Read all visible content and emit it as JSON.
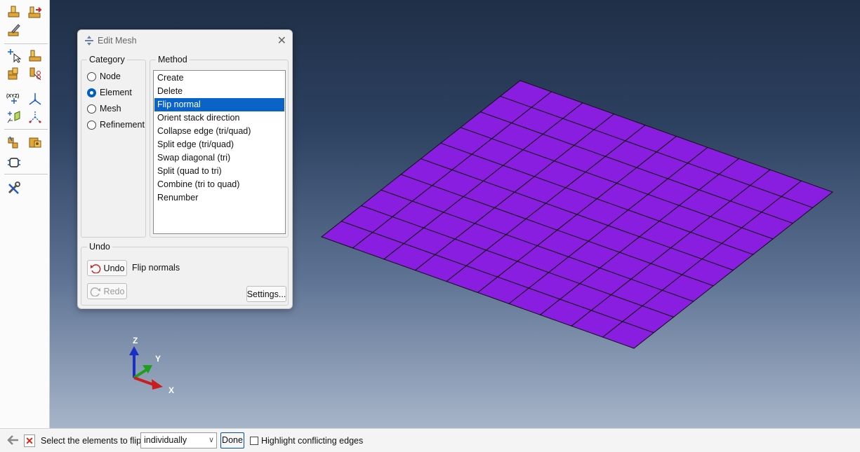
{
  "dialog": {
    "title": "Edit Mesh",
    "category_label": "Category",
    "categories": [
      {
        "label": "Node",
        "selected": false
      },
      {
        "label": "Element",
        "selected": true
      },
      {
        "label": "Mesh",
        "selected": false
      },
      {
        "label": "Refinement",
        "selected": false
      }
    ],
    "method_label": "Method",
    "methods": [
      {
        "label": "Create",
        "selected": false
      },
      {
        "label": "Delete",
        "selected": false
      },
      {
        "label": "Flip normal",
        "selected": true
      },
      {
        "label": "Orient stack direction",
        "selected": false
      },
      {
        "label": "Collapse edge (tri/quad)",
        "selected": false
      },
      {
        "label": "Split edge (tri/quad)",
        "selected": false
      },
      {
        "label": "Swap diagonal (tri)",
        "selected": false
      },
      {
        "label": "Split (quad to tri)",
        "selected": false
      },
      {
        "label": "Combine (tri to quad)",
        "selected": false
      },
      {
        "label": "Renumber",
        "selected": false
      }
    ],
    "undo_group_label": "Undo",
    "undo_button": "Undo",
    "undo_description": "Flip normals",
    "redo_button": "Redo",
    "settings_button": "Settings..."
  },
  "prompt": {
    "text": "Select the elements to flip",
    "selection_mode": "individually",
    "done_button": "Done",
    "highlight_checkbox_label": "Highlight conflicting edges",
    "highlight_checked": false
  },
  "triad": {
    "x": "X",
    "y": "Y",
    "z": "Z"
  },
  "mesh": {
    "rows": 10,
    "cols": 10,
    "fill_color": "#8a1ee0",
    "edge_color": "#111111"
  },
  "colors": {
    "accent": "#0a64c8"
  }
}
